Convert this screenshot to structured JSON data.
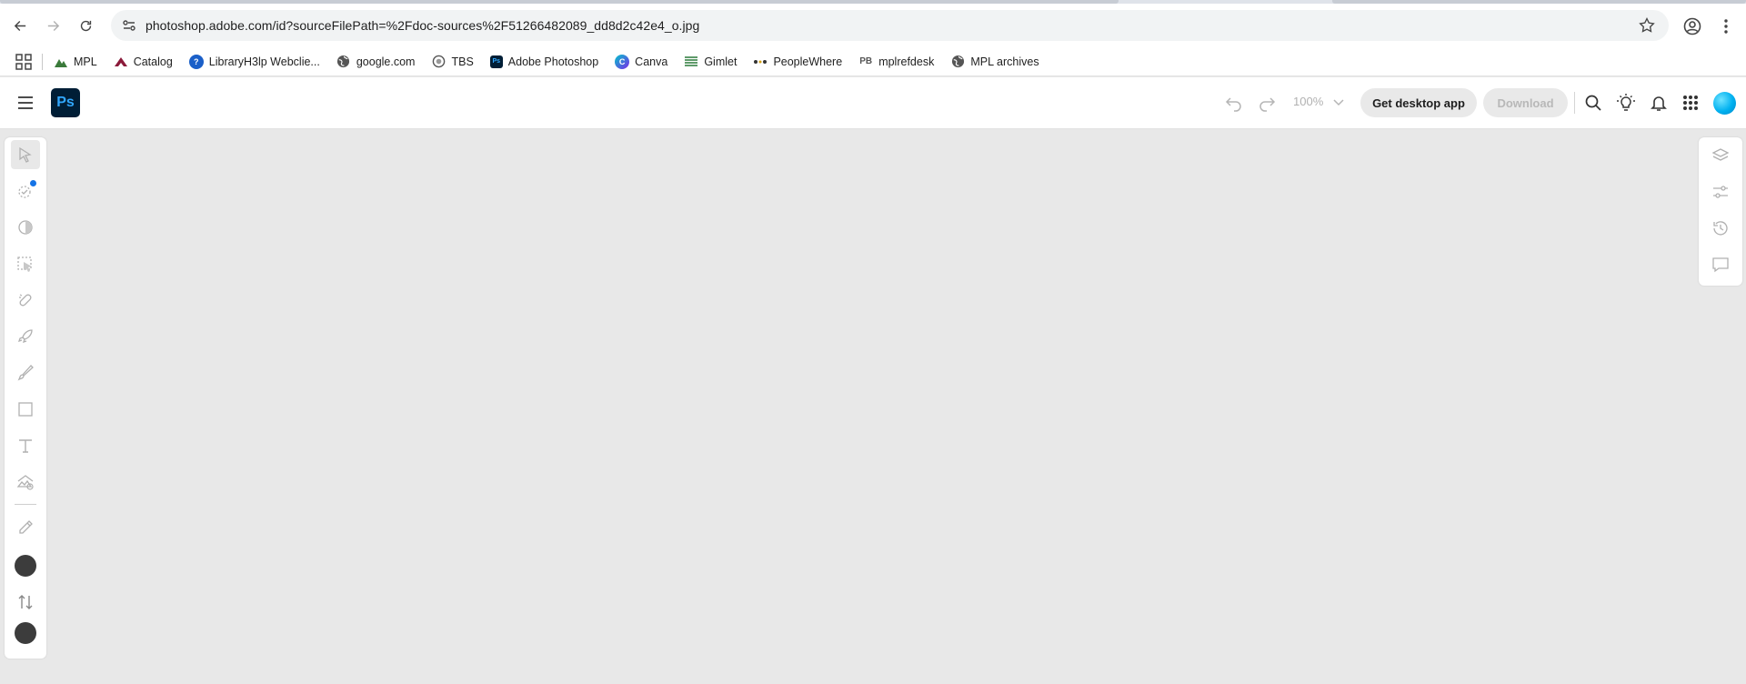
{
  "browser": {
    "url": "photoshop.adobe.com/id?sourceFilePath=%2Fdoc-sources%2F51266482089_dd8d2c42e4_o.jpg",
    "bookmarks": [
      {
        "label": "MPL",
        "icon": "mountain-icon",
        "color": "#3a7a3a"
      },
      {
        "label": "Catalog",
        "icon": "catalog-icon",
        "color": "#8b1a3a"
      },
      {
        "label": "LibraryH3lp Webclie...",
        "icon": "help-icon",
        "color": "#1a5fc8"
      },
      {
        "label": "google.com",
        "icon": "globe-icon",
        "color": "#555555"
      },
      {
        "label": "TBS",
        "icon": "tbs-icon",
        "color": "#555555"
      },
      {
        "label": "Adobe Photoshop",
        "icon": "photoshop-icon",
        "color": "#001e36"
      },
      {
        "label": "Canva",
        "icon": "canva-icon",
        "color": "#7d2ae8"
      },
      {
        "label": "Gimlet",
        "icon": "gimlet-icon",
        "color": "#2a7a3a"
      },
      {
        "label": "PeopleWhere",
        "icon": "peoplewhere-icon",
        "color": "#333333"
      },
      {
        "label": "mplrefdesk",
        "icon": "pb-icon",
        "color": "#555555"
      },
      {
        "label": "MPL archives",
        "icon": "globe-icon",
        "color": "#555555"
      }
    ]
  },
  "header": {
    "logo": "Ps",
    "zoom": "100%",
    "get_desktop_label": "Get desktop app",
    "download_label": "Download"
  },
  "colors": {
    "canvas_bg": "#e8e8e8",
    "accent": "#1473e6",
    "swatch": "#3c3c3c"
  }
}
